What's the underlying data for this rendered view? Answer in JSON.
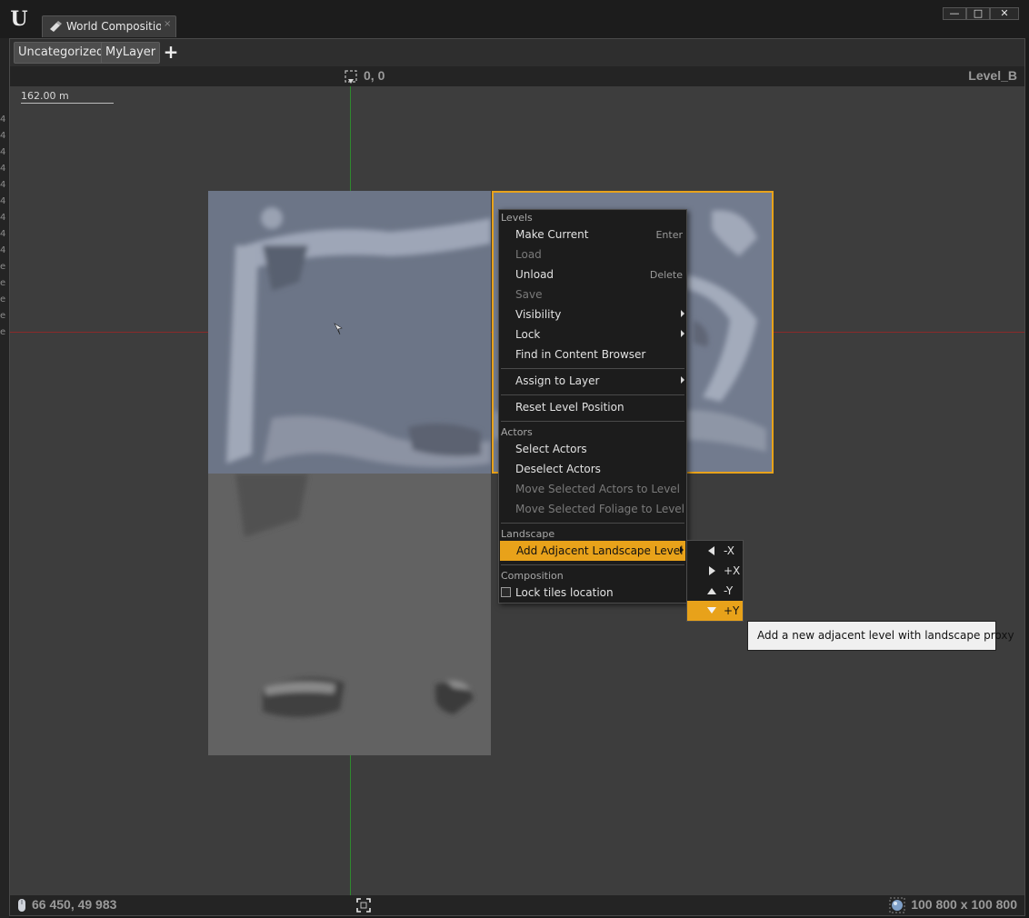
{
  "window": {
    "tab_title": "World Composition",
    "tab_close": "×",
    "tab_icon": "world-composition-icon",
    "controls": {
      "minimize": "—",
      "maximize": "□",
      "close": "✕"
    }
  },
  "left_strip_chars": [
    "4",
    "4",
    "4",
    "4",
    "4",
    "4",
    "4",
    "4",
    "4",
    "e",
    "e",
    "e",
    "e",
    "e"
  ],
  "layers": {
    "items": [
      "Uncategorized",
      "MyLayer"
    ],
    "add_label": "+"
  },
  "viewport": {
    "origin_label": "0, 0",
    "level_name": "Level_B",
    "scale_label": "162.00 m",
    "mouse_coords": "66 450, 49 983",
    "world_size": "100 800 x 100 800",
    "colors": {
      "selection": "#e8a21a",
      "axis_x": "#8a2a2a",
      "axis_y": "#2f8a2f"
    }
  },
  "context_menu": {
    "sections": {
      "levels": "Levels",
      "actors": "Actors",
      "landscape": "Landscape",
      "composition": "Composition"
    },
    "items": {
      "make_current": {
        "label": "Make Current",
        "shortcut": "Enter"
      },
      "load": {
        "label": "Load"
      },
      "unload": {
        "label": "Unload",
        "shortcut": "Delete"
      },
      "save": {
        "label": "Save"
      },
      "visibility": {
        "label": "Visibility"
      },
      "lock": {
        "label": "Lock"
      },
      "find_in_cb": {
        "label": "Find in Content Browser"
      },
      "assign_layer": {
        "label": "Assign to Layer"
      },
      "reset_position": {
        "label": "Reset Level Position"
      },
      "select_actors": {
        "label": "Select Actors"
      },
      "deselect_actors": {
        "label": "Deselect Actors"
      },
      "move_actors": {
        "label": "Move Selected Actors to Level"
      },
      "move_foliage": {
        "label": "Move Selected Foliage to Level"
      },
      "add_adjacent": {
        "label": "Add Adjacent Landscape Level"
      },
      "lock_tiles": {
        "label": "Lock tiles location"
      }
    }
  },
  "submenu": {
    "items": [
      "-X",
      "+X",
      "-Y",
      "+Y"
    ]
  },
  "tooltip": "Add a new adjacent level with landscape proxy"
}
